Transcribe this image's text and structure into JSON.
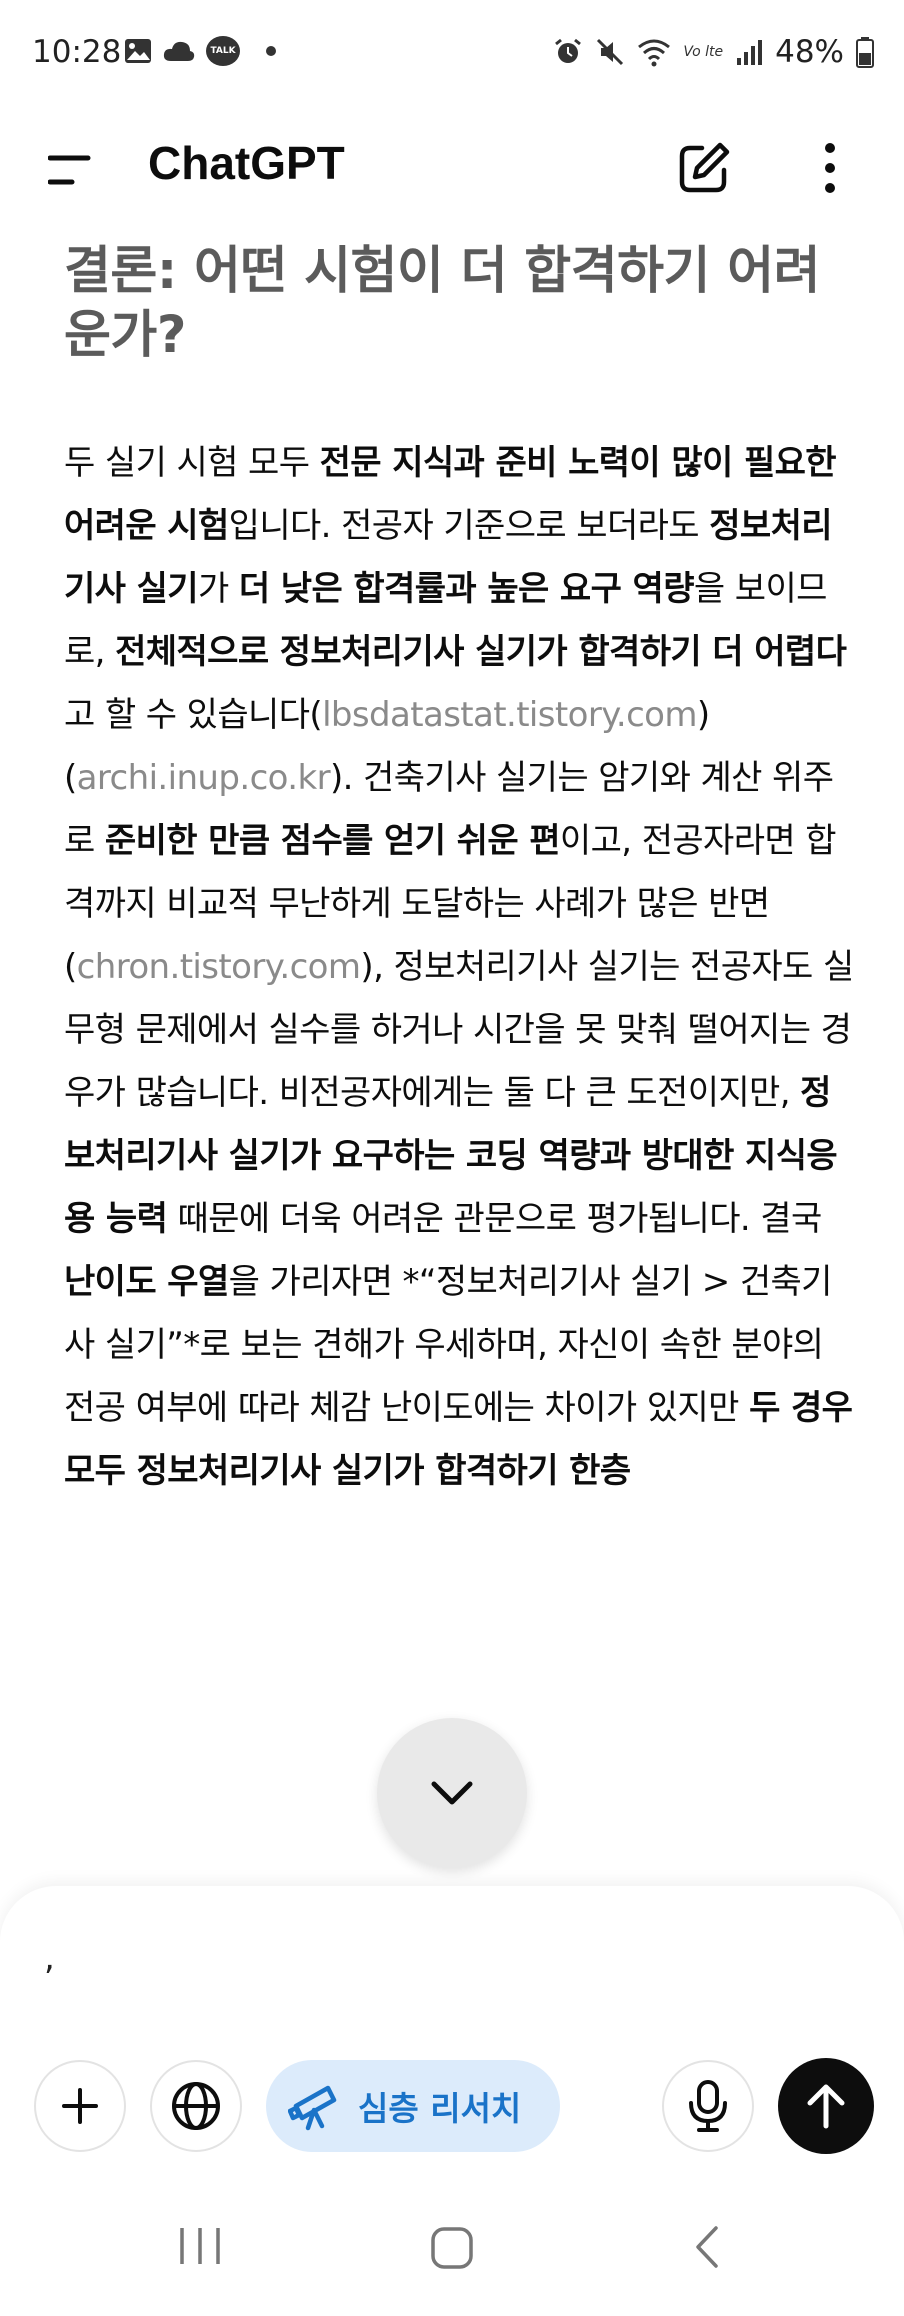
{
  "status_bar": {
    "time": "10:28",
    "left_icons": [
      "gallery-icon",
      "cloud-icon",
      "talk-icon",
      "dot-icon"
    ],
    "talk_badge": "TALK",
    "right_icons": [
      "alarm-icon",
      "mute-icon",
      "wifi-icon",
      "volte-icon",
      "signal-icon"
    ],
    "volte_label": "Vo lte",
    "battery": "48%"
  },
  "header": {
    "title": "ChatGPT",
    "icons": [
      "menu-icon",
      "new-chat-icon",
      "more-vertical-icon"
    ]
  },
  "content": {
    "heading": "결론: 어떤 시험이 더 합격하기 어려운가?",
    "segments": [
      {
        "text": "두 실기 시험 모두 ",
        "style": "normal"
      },
      {
        "text": "전문 지식과 준비 노력이 많이 필요한 어려운 시험",
        "style": "bold"
      },
      {
        "text": "입니다. 전공자 기준으로 보더라도 ",
        "style": "normal"
      },
      {
        "text": "정보처리기사 실기",
        "style": "bold"
      },
      {
        "text": "가 ",
        "style": "normal"
      },
      {
        "text": "더 낮은 합격률과 높은 요구 역량",
        "style": "bold"
      },
      {
        "text": "을 보이므로, ",
        "style": "normal"
      },
      {
        "text": "전체적으로 정보처리기사 실기가 합격하기 더 어렵다",
        "style": "bold"
      },
      {
        "text": "고 할 수 있습니다(",
        "style": "normal"
      },
      {
        "text": "lbsdatastat.tistory.com",
        "style": "source"
      },
      {
        "text": ")(",
        "style": "normal"
      },
      {
        "text": "archi.inup.co.kr",
        "style": "source"
      },
      {
        "text": "). 건축기사 실기는 암기와 계산 위주로 ",
        "style": "normal"
      },
      {
        "text": "준비한 만큼 점수를 얻기 쉬운 편",
        "style": "bold"
      },
      {
        "text": "이고, 전공자라면 합격까지 비교적 무난하게 도달하는 사례가 많은 반면(",
        "style": "normal"
      },
      {
        "text": "chron.tistory.com",
        "style": "source"
      },
      {
        "text": "), 정보처리기사 실기는 전공자도 실무형 문제에서 실수를 하거나 시간을 못 맞춰 떨어지는 경우가 많습니다. 비전공자에게는 둘 다 큰 도전이지만, ",
        "style": "normal"
      },
      {
        "text": "정보처리기사 실기가 요구하는 코딩 역량과 방대한 지식응용 능력",
        "style": "bold"
      },
      {
        "text": " 때문에 더욱 어려운 관문으로 평가됩니다. 결국 ",
        "style": "normal"
      },
      {
        "text": "난이도 우열",
        "style": "bold"
      },
      {
        "text": "을 가리자면 *“정보처리기사 실기 > 건축기사 실기”*로 보는 견해가 우세하며, 자신이 속한 분야의 전공 여부에 따라 체감 난이도에는 차이가 있지만 ",
        "style": "normal"
      },
      {
        "text": "두 경우 모두 정보처리기사 실기가 합격하기 한층",
        "style": "bold"
      }
    ]
  },
  "scroll_button": {
    "icon": "chevron-down-icon"
  },
  "composer": {
    "input_value": ",",
    "research_label": "심층 리서치",
    "icons": [
      "plus-icon",
      "globe-icon",
      "telescope-icon",
      "microphone-icon",
      "arrow-up-icon"
    ],
    "accent_color": "#1a73c8",
    "research_bg": "#dcebfb"
  },
  "nav_bar": {
    "icons": [
      "recents-icon",
      "home-icon",
      "back-icon"
    ]
  }
}
